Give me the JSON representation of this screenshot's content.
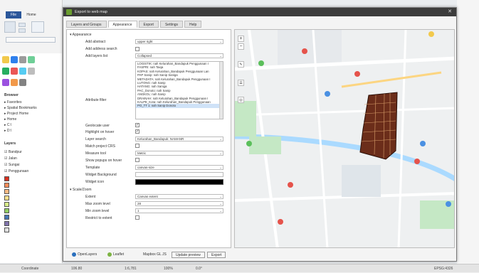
{
  "dialog": {
    "title": "Export to web map",
    "tabs": [
      "Layers and Groups",
      "Appearance",
      "Export",
      "Settings",
      "Help"
    ],
    "active_tab": "Appearance"
  },
  "settings": {
    "group_appearance": "Appearance",
    "add_abstract_label": "Add abstract",
    "add_abstract_value": "upper right",
    "add_address_search_label": "Add address search",
    "add_layers_list_label": "Add layers list",
    "add_layers_list_value": "Collapsed",
    "attribute_filter_label": "Attribute filter",
    "attribute_filter_items": [
      "LOGISTIK: nah Kelurahan_Bandapuk Penggunaan I",
      "FASPRI: nah Taiqa",
      "KOPAS: nah Kelurahan_Bandapuk Penggunaan Lan",
      "PAP Sanip: nah Sanip Saniga",
      "METADATA: nah Kelurahan_Bandapuk Penggunaan I",
      "LUTONG: nah Sanip",
      "HATANG: nah Saniga",
      "PAC_Donoto: nah Sanip",
      "ANGKOL: nah Sanip",
      "DRAINAH: nah Kelurahan_Bandapuk Penggunaan I",
      "KALPE_Kota: nah Kelurahan_Bandapuk Penggunaan",
      "PO_TT 1: nah Sanip Donoto"
    ],
    "geolocate_user_label": "Geolocate user",
    "highlight_label": "Highlight on hover",
    "layer_search_label": "Layer search",
    "layer_search_value": "Kelurahan_Bandapuk: NAMANR",
    "match_project_crs_label": "Match project CRS",
    "measure_tool_label": "Measure tool",
    "measure_tool_value": "Metric",
    "show_popups_label": "Show popups on hover",
    "template_label": "Template",
    "template_value": "canvas-size",
    "widget_bg_label": "Widget Background",
    "widget_icon_label": "Widget icon",
    "group_scale_zoom": "Scale/Zoom",
    "extent_label": "Extent",
    "extent_value": "Canvas extent",
    "max_zoom_label": "Max zoom level",
    "max_zoom_value": "28",
    "min_zoom_label": "Min zoom level",
    "min_zoom_value": "1",
    "restrict_label": "Restrict to extent"
  },
  "bottom_bar": {
    "open_layers": "OpenLayers",
    "leaflet": "Leaflet",
    "mapbox": "Mapbox GL JS",
    "update_preview": "Update preview",
    "export": "Export"
  },
  "status_bar": {
    "coordinate": "Coordinate",
    "coord_value": "106.80",
    "scale": "1:6,781",
    "magnifier": "100%",
    "rotation": "0.0°",
    "crs": "EPSG:4326"
  },
  "layers_panel": {
    "title": "Layers",
    "items": [
      "Bandpur",
      "Jalan",
      "Sungai",
      "Penggunaan"
    ]
  },
  "map": {
    "colors": {
      "parcel": "#6b2d1a",
      "road": "#ffffff",
      "park": "#c5e8c5",
      "water": "#aadaff",
      "poi_red": "#e5534b",
      "poi_blue": "#4a90e2"
    }
  }
}
